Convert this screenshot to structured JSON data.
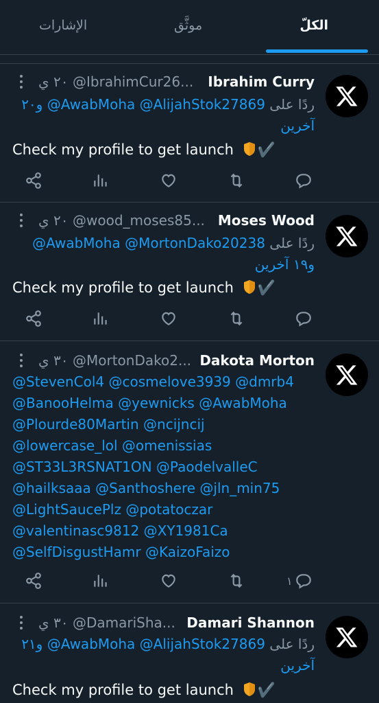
{
  "tabs": [
    {
      "label": "الكلّ",
      "active": true
    },
    {
      "label": "موثَّق",
      "active": false
    },
    {
      "label": "الإشارات",
      "active": false
    }
  ],
  "tweets": [
    {
      "name": "Ibrahim Curry",
      "handle": "@IbrahimCur26...",
      "time": "٢٠ ي",
      "reply_prefix": "ردًا على",
      "reply_mentions": "@AwabMoha @AlijahStok27869",
      "reply_suffix": "و٢٠",
      "reply_suffix2": "آخرين",
      "body": "Check my profile to get launch",
      "body_emoji": "✔️",
      "reply_count": ""
    },
    {
      "name": "Moses Wood",
      "handle": "@wood_moses85...",
      "time": "٢٠ ي",
      "reply_prefix": "ردًا على",
      "reply_mentions": "@AwabMoha @MortonDako20238",
      "reply_suffix": "و١٩ آخرين",
      "body": "Check my profile to get launch",
      "body_emoji": "✔️",
      "reply_count": ""
    },
    {
      "name": "Dakota Morton",
      "handle": "@MortonDako2...",
      "time": "٣٠ ي",
      "mention_lines": [
        "@StevenCol4 @cosmelove3939 @dmrb4",
        "@BanooHelma @yewnicks @AwabMoha",
        "@Plourde80Martin @ncijncij",
        "@lowercase_lol @omenissias",
        "@ST33L3RSNAT1ON @PaodelvalleC",
        "@hailksaaa @Santhoshere @jln_min75",
        "@LightSaucePlz @potatoczar",
        "@valentinasc9812 @XY1981Ca",
        "@SelfDisgustHamr @KaizoFaizo"
      ],
      "reply_count": "١"
    },
    {
      "name": "Damari Shannon",
      "handle": "@DamariSha...",
      "time": "٣٠ ي",
      "reply_prefix": "ردًا على",
      "reply_mentions": "@AwabMoha @AlijahStok27869",
      "reply_suffix": "و٢١",
      "reply_suffix2": "آخرين",
      "body": "Check my profile to get launch",
      "body_emoji": "✔️"
    }
  ],
  "colors": {
    "background": "#15202b",
    "accent": "#1d9bf0",
    "muted": "#8b98a5",
    "divider": "#38444d"
  },
  "icons": [
    "share-icon",
    "views-icon",
    "like-icon",
    "retweet-icon",
    "reply-icon",
    "x-logo-icon",
    "more-icon",
    "shield-icon"
  ]
}
